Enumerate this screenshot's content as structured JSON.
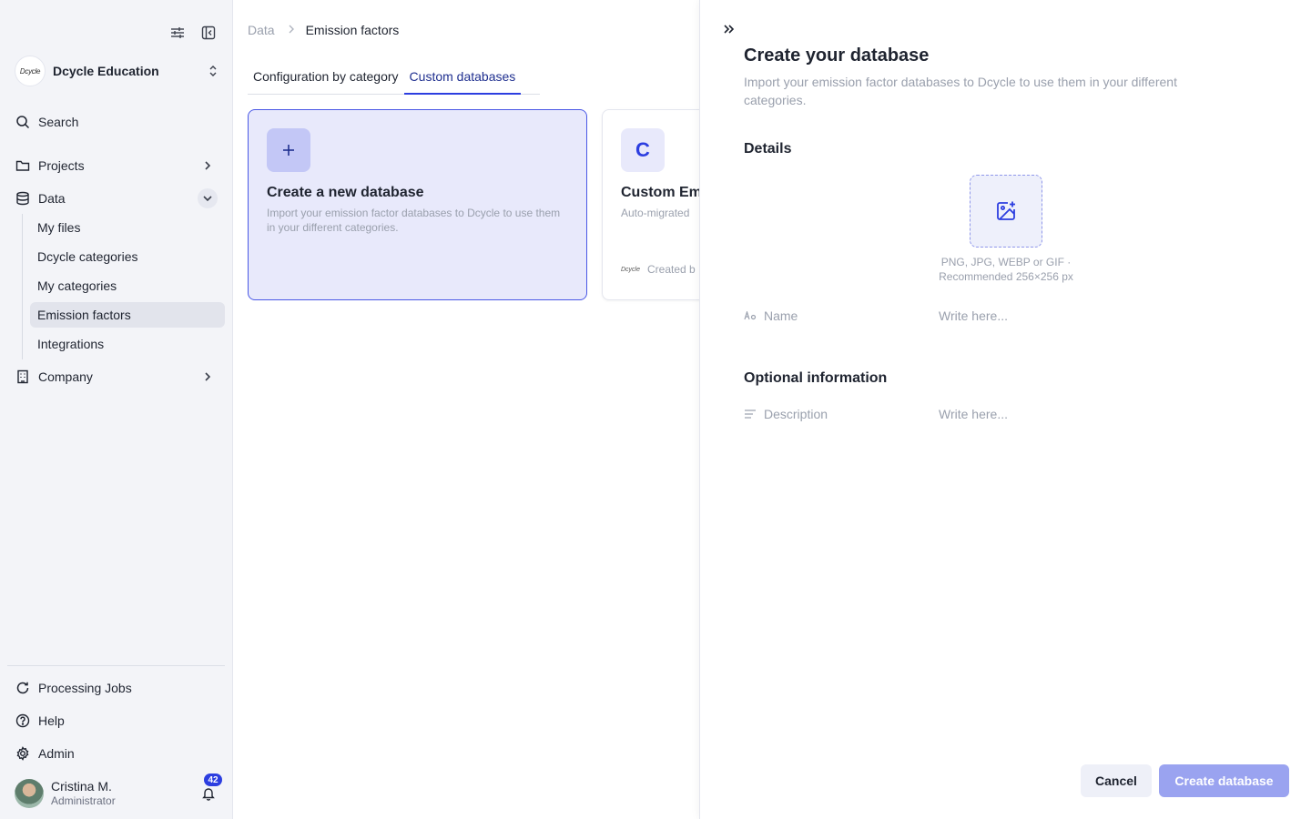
{
  "sidebar": {
    "org_name": "Dcycle Education",
    "org_logo_text": "Dcycle",
    "nav": {
      "search": "Search",
      "projects": "Projects",
      "data": "Data",
      "company": "Company"
    },
    "data_sub": [
      "My files",
      "Dcycle categories",
      "My categories",
      "Emission factors",
      "Integrations"
    ],
    "active_sub": "Emission factors",
    "bottom": {
      "processing_jobs": "Processing Jobs",
      "help": "Help",
      "admin": "Admin"
    },
    "user": {
      "name": "Cristina M.",
      "role": "Administrator",
      "notifications": "42"
    }
  },
  "main": {
    "breadcrumb": [
      "Data",
      "Emission factors"
    ],
    "tabs": [
      "Configuration by category",
      "Custom databases"
    ],
    "active_tab": "Custom databases",
    "new_card": {
      "title": "Create a new database",
      "description": "Import your emission factor databases to Dcycle to use them in your different categories."
    },
    "db_card": {
      "initial": "C",
      "title": "Custom Em",
      "description": "Auto-migrated",
      "footer_logo": "Dcycle",
      "footer_text": "Created b"
    }
  },
  "panel": {
    "title": "Create your database",
    "subtitle": "Import your emission factor databases to Dcycle to use them in your different categories.",
    "details_heading": "Details",
    "upload_hint": "PNG, JPG, WEBP or GIF · Recommended 256×256 px",
    "name_label": "Name",
    "name_placeholder": "Write here...",
    "optional_heading": "Optional information",
    "description_label": "Description",
    "description_placeholder": "Write here...",
    "cancel_label": "Cancel",
    "create_label": "Create database"
  },
  "colors": {
    "accent": "#2c3ee0",
    "sidebar_bg": "#f3f4f8",
    "card_highlight": "#e8e9fb",
    "button_disabled": "#9aa3f0"
  }
}
